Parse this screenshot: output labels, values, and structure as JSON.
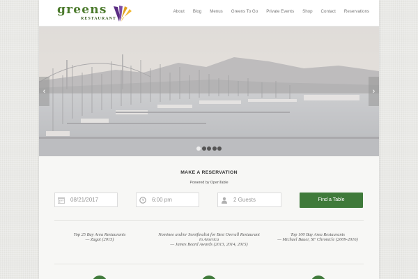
{
  "brand": {
    "name": "greens",
    "subtitle": "RESTAURANT",
    "green": "#4b7a2c",
    "purple": "#5a2d82",
    "gold": "#e0a21e"
  },
  "nav": {
    "items": [
      {
        "label": "About"
      },
      {
        "label": "Blog"
      },
      {
        "label": "Menus"
      },
      {
        "label": "Greens To Go"
      },
      {
        "label": "Private Events"
      },
      {
        "label": "Shop"
      },
      {
        "label": "Contact"
      },
      {
        "label": "Reservations"
      }
    ]
  },
  "hero": {
    "prev_icon": "chevron-left-icon",
    "next_icon": "chevron-right-icon",
    "prev_glyph": "‹",
    "next_glyph": "›",
    "slide_count": 5,
    "active_slide": 1
  },
  "reservation": {
    "title": "MAKE A RESERVATION",
    "powered_by": "Powered by OpenTable",
    "date_value": "08/21/2017",
    "time_value": "6:00 pm",
    "guests_value": "2 Guests",
    "button_label": "Find a Table",
    "accent": "#3f7a3a"
  },
  "accolades": [
    {
      "title": "Top 25 Bay Area Restaurants",
      "source": "— Zagat (2015)"
    },
    {
      "title": "Nominee and/or Semifinalist for Best Overall Restaurant in America",
      "source": "— James Beard Awards (2013, 2014, 2015)"
    },
    {
      "title": "Top 100 Bay Area Restaurants",
      "source": "— Michael Bauer, SF Chronicle (2009-2016)"
    }
  ]
}
